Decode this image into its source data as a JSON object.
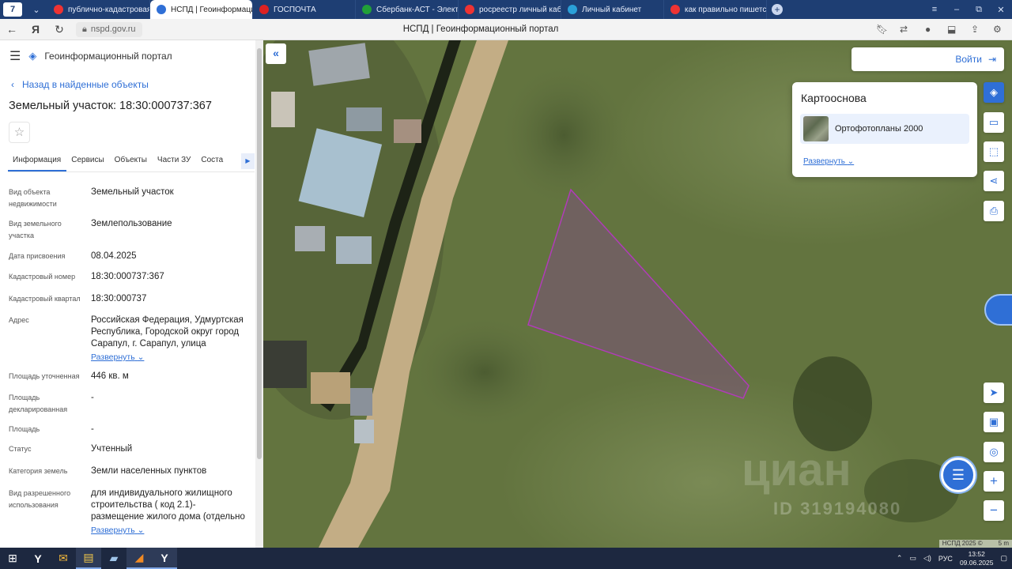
{
  "browser": {
    "tabs": [
      {
        "title": "публично-кадастровая к",
        "active": false,
        "color": "#e33"
      },
      {
        "title": "НСПД | Геоинформацио",
        "active": true,
        "color": "#2f6fd6"
      },
      {
        "title": "ГОСПОЧТА",
        "active": false,
        "color": "#d22"
      },
      {
        "title": "Сбербанк-АСТ - Электро",
        "active": false,
        "color": "#21a038"
      },
      {
        "title": "росреестр личный кабин",
        "active": false,
        "color": "#e33"
      },
      {
        "title": "Личный кабинет",
        "active": false,
        "color": "#2aa0d8"
      },
      {
        "title": "как правильно пишется к",
        "active": false,
        "color": "#e33"
      }
    ],
    "url": "nspd.gov.ru",
    "page_title": "НСПД | Геоинформационный портал"
  },
  "sidebar": {
    "brand": "Геоинформационный портал",
    "back_link": "Назад в найденные объекты",
    "object_title": "Земельный участок: 18:30:000737:367",
    "tabs": [
      "Информация",
      "Сервисы",
      "Объекты",
      "Части ЗУ",
      "Соста"
    ],
    "fields": [
      {
        "key": "Вид объекта недвижимости",
        "value": "Земельный участок"
      },
      {
        "key": "Вид земельного участка",
        "value": "Землепользование"
      },
      {
        "key": "Дата присвоения",
        "value": "08.04.2025"
      },
      {
        "key": "Кадастровый номер",
        "value": "18:30:000737:367"
      },
      {
        "key": "Кадастровый квартал",
        "value": "18:30:000737"
      },
      {
        "key": "Адрес",
        "value": "Российская Федерация, Удмуртская Республика, Городской округ город Сарапул, г. Сарапул, улица",
        "link": "Развернуть"
      },
      {
        "key": "Площадь уточненная",
        "value": "446 кв. м"
      },
      {
        "key": "Площадь декларированная",
        "value": "-"
      },
      {
        "key": "Площадь",
        "value": "-"
      },
      {
        "key": "Статус",
        "value": "Учтенный"
      },
      {
        "key": "Категория земель",
        "value": "Земли населенных пунктов"
      },
      {
        "key": "Вид разрешенного использования",
        "value": "для индивидуального жилищного строительства ( код 2.1)- размещение жилого дома (отдельно",
        "link": "Развернуть"
      }
    ]
  },
  "map": {
    "login_label": "Войти",
    "basemap_title": "Картооснова",
    "basemap_item": "Ортофотопланы 2000",
    "basemap_expand": "Развернуть",
    "attribution": "НСПД 2025 ©",
    "scale": "5 m",
    "watermark": "циан",
    "watermark_id": "ID 319194080",
    "parcel_color": "#b03cb8"
  },
  "taskbar": {
    "lang": "РУС",
    "time": "13:52",
    "date": "09.06.2025"
  }
}
